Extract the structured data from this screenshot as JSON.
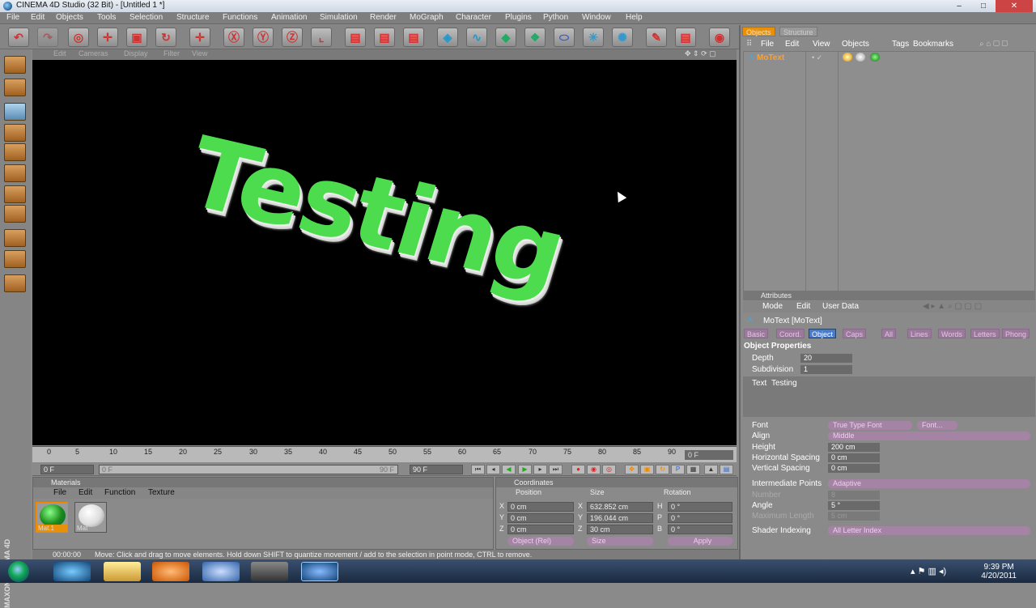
{
  "window": {
    "title": "CINEMA 4D Studio (32 Bit) - [Untitled 1 *]",
    "min": "–",
    "max": "□",
    "close": "✕"
  },
  "menu": [
    "File",
    "Edit",
    "Objects",
    "Tools",
    "Selection",
    "Structure",
    "Functions",
    "Animation",
    "Simulation",
    "Render",
    "MoGraph",
    "Character",
    "Plugins",
    "Python",
    "Window",
    "Help"
  ],
  "viewport": {
    "menu": [
      "Edit",
      "Cameras",
      "Display",
      "Filter",
      "View"
    ],
    "text3d": "Testing"
  },
  "timeline": {
    "ticks": [
      "0",
      "5",
      "10",
      "15",
      "20",
      "25",
      "30",
      "35",
      "40",
      "45",
      "50",
      "55",
      "60",
      "65",
      "70",
      "75",
      "80",
      "85",
      "90"
    ],
    "current": "0 F",
    "start": "0 F",
    "range_start": "0 F",
    "range_end": "90 F",
    "end": "90 F"
  },
  "materials": {
    "title": "Materials",
    "menu": [
      "File",
      "Edit",
      "Function",
      "Texture"
    ],
    "items": [
      {
        "name": "Mat.1",
        "color": "#1fa21f"
      },
      {
        "name": "Mat",
        "color": "#f2f2f2"
      }
    ]
  },
  "coords": {
    "title": "Coordinates",
    "headers": [
      "Position",
      "Size",
      "Rotation"
    ],
    "rows": [
      {
        "axis": "X",
        "pos": "0 cm",
        "sizeaxis": "X",
        "size": "632.852 cm",
        "rotaxis": "H",
        "rot": "0 °"
      },
      {
        "axis": "Y",
        "pos": "0 cm",
        "sizeaxis": "Y",
        "size": "196.044 cm",
        "rotaxis": "P",
        "rot": "0 °"
      },
      {
        "axis": "Z",
        "pos": "0 cm",
        "sizeaxis": "Z",
        "size": "30 cm",
        "rotaxis": "B",
        "rot": "0 °"
      }
    ],
    "mode": "Object (Rel)",
    "sizemode": "Size",
    "apply": "Apply"
  },
  "status": {
    "time": "00:00:00",
    "message": "Move: Click and drag to move elements. Hold down SHIFT to quantize movement / add to the selection in point mode, CTRL to remove."
  },
  "objects": {
    "tabs": [
      "Objects",
      "Structure"
    ],
    "menu": [
      "File",
      "Edit",
      "View",
      "Objects",
      "Tags",
      "Bookmarks"
    ],
    "item": "MoText"
  },
  "attributes": {
    "title": "Attributes",
    "menu": [
      "Mode",
      "Edit",
      "User Data"
    ],
    "object": "MoText [MoText]",
    "tabs": [
      "Basic",
      "Coord.",
      "Object",
      "Caps",
      "All",
      "Lines",
      "Words",
      "Letters",
      "Phong"
    ],
    "section": "Object Properties",
    "depth_label": "Depth",
    "depth": "20",
    "subdiv_label": "Subdivision",
    "subdiv": "1",
    "text_label": "Text",
    "text": "Testing",
    "font_label": "Font",
    "font_type": "True Type Font",
    "font_btn": "Font...",
    "align_label": "Align",
    "align": "Middle",
    "height_label": "Height",
    "height": "200 cm",
    "hspace_label": "Horizontal Spacing",
    "hspace": "0 cm",
    "vspace_label": "Vertical Spacing",
    "vspace": "0 cm",
    "ip_label": "Intermediate Points",
    "ip": "Adaptive",
    "number_label": "Number",
    "number": "8",
    "angle_label": "Angle",
    "angle": "5 °",
    "maxlen_label": "Maximum Length",
    "maxlen": "5 cm",
    "shader_label": "Shader Indexing",
    "shader": "All Letter Index"
  },
  "brand": "MAXON CINEMA 4D",
  "clock": {
    "time": "9:39 PM",
    "date": "4/20/2011"
  }
}
